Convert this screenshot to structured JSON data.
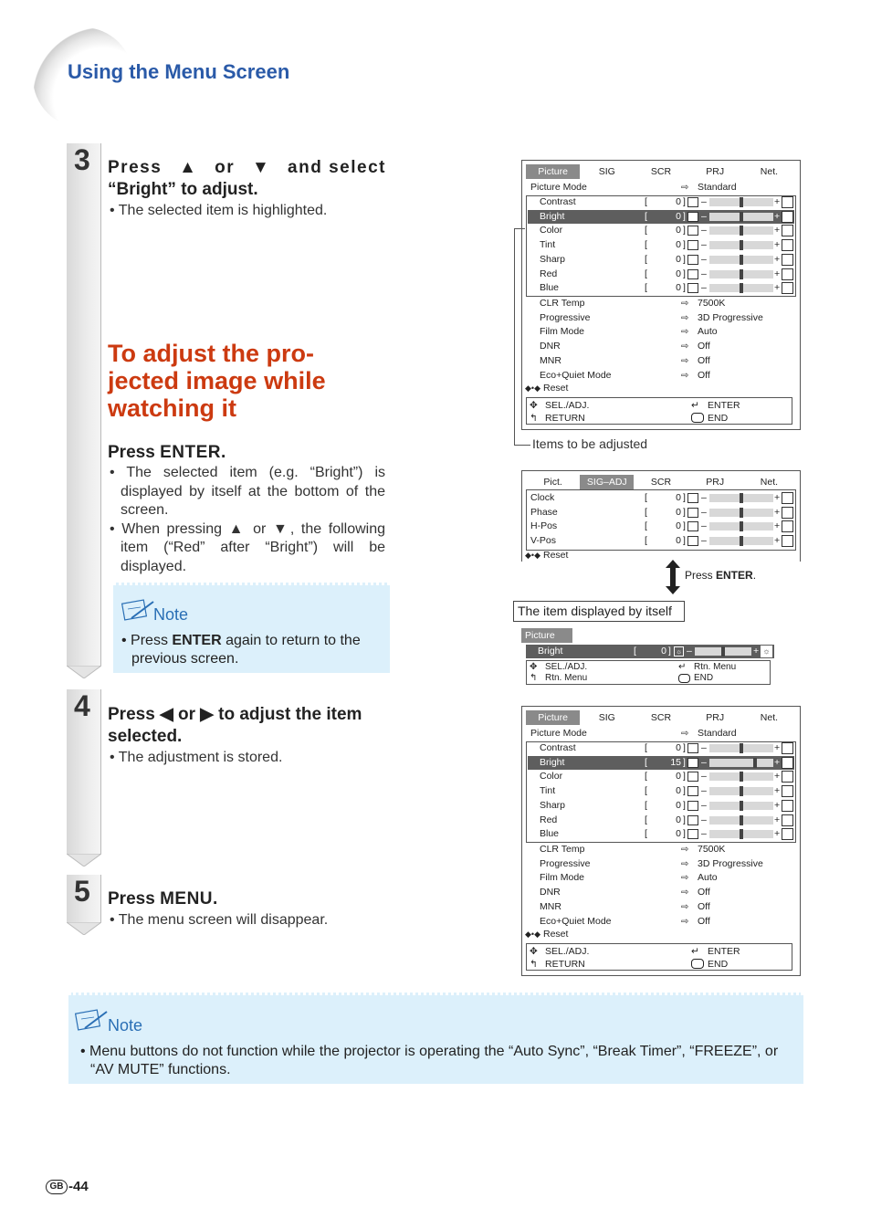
{
  "section_title": "Using the Menu Screen",
  "steps": [
    {
      "number": "3",
      "heading_parts": [
        "Press",
        "or",
        "and select “Bright” to adjust."
      ],
      "bullets": [
        "The selected item is highlighted."
      ]
    },
    {
      "number": "4",
      "heading_parts": [
        "Press",
        "or",
        "to adjust the item selected."
      ],
      "bullets": [
        "The adjustment is stored."
      ]
    },
    {
      "number": "5",
      "heading_parts": [
        "Press",
        "MENU",
        "."
      ],
      "bullets": [
        "The menu screen will disappear."
      ]
    }
  ],
  "subsection": {
    "title_lines": [
      "To adjust the pro-",
      "jected image while",
      "watching it"
    ],
    "press_label": "Press",
    "press_key": "ENTER",
    "press_suffix": ".",
    "bullets": [
      "The selected item (e.g. “Bright”) is displayed by itself at the bottom of the screen.",
      "When pressing ▲ or ▼, the following item (“Red” after “Bright”) will be displayed."
    ],
    "note": {
      "title": "Note",
      "text_pre": "Press ",
      "text_key": "ENTER",
      "text_post": " again to return to the previous screen."
    }
  },
  "bottom_note": {
    "title": "Note",
    "text": "Menu buttons do not function while the projector is operating the “Auto Sync”, “Break Timer”, “FREEZE”, or “AV MUTE” functions."
  },
  "annotations": {
    "items_to_adjust": "Items to be adjusted",
    "item_displayed_itself": "The item displayed by itself",
    "press_enter_pre": "Press ",
    "press_enter_key": "ENTER",
    "press_enter_post": "."
  },
  "menu1": {
    "tabs": [
      "Picture",
      "SIG",
      "SCR",
      "PRJ",
      "Net."
    ],
    "active_tab": 0,
    "picture_mode_label": "Picture Mode",
    "picture_mode_value": "Standard",
    "adjust_rows": [
      {
        "label": "Contrast",
        "value": "0",
        "level": 0.5,
        "icon": "contrast-icon"
      },
      {
        "label": "Bright",
        "value": "0",
        "level": 0.5,
        "icon": "brightness-icon",
        "highlight": true
      },
      {
        "label": "Color",
        "value": "0",
        "level": 0.5,
        "icon": "color-icon"
      },
      {
        "label": "Tint",
        "value": "0",
        "level": 0.5,
        "icon": "tint-icon"
      },
      {
        "label": "Sharp",
        "value": "0",
        "level": 0.5,
        "icon": "sharp-icon"
      },
      {
        "label": "Red",
        "value": "0",
        "level": 0.5,
        "icon": "red-icon"
      },
      {
        "label": "Blue",
        "value": "0",
        "level": 0.5,
        "icon": "blue-icon"
      }
    ],
    "setting_rows": [
      {
        "label": "CLR Temp",
        "value": "7500K"
      },
      {
        "label": "Progressive",
        "value": "3D Progressive"
      },
      {
        "label": "Film Mode",
        "value": "Auto"
      },
      {
        "label": "DNR",
        "value": "Off"
      },
      {
        "label": "MNR",
        "value": "Off"
      },
      {
        "label": "Eco+Quiet Mode",
        "value": "Off"
      }
    ],
    "reset_label": "Reset",
    "footer": {
      "sel_adj": "SEL./ADJ.",
      "return": "RETURN",
      "enter": "ENTER",
      "end": "END"
    }
  },
  "menu2": {
    "tabs": [
      "Pict.",
      "SIG–ADJ",
      "SCR",
      "PRJ",
      "Net."
    ],
    "active_tab": 1,
    "adjust_rows": [
      {
        "label": "Clock",
        "value": "0",
        "level": 0.5,
        "icon": "clock-icon"
      },
      {
        "label": "Phase",
        "value": "0",
        "level": 0.5,
        "icon": "phase-icon"
      },
      {
        "label": "H-Pos",
        "value": "0",
        "level": 0.5,
        "icon": "hpos-icon"
      },
      {
        "label": "V-Pos",
        "value": "0",
        "level": 0.5,
        "icon": "vpos-icon"
      }
    ],
    "reset_label": "Reset"
  },
  "menu_single": {
    "tab": "Picture",
    "row": {
      "label": "Bright",
      "value": "0",
      "level": 0.5
    },
    "footer": {
      "sel_adj": "SEL./ADJ.",
      "rtn_menu_left": "Rtn. Menu",
      "rtn_menu_right": "Rtn. Menu",
      "end": "END"
    }
  },
  "menu3": {
    "tabs": [
      "Picture",
      "SIG",
      "SCR",
      "PRJ",
      "Net."
    ],
    "active_tab": 0,
    "picture_mode_label": "Picture Mode",
    "picture_mode_value": "Standard",
    "adjust_rows": [
      {
        "label": "Contrast",
        "value": "0",
        "level": 0.5
      },
      {
        "label": "Bright",
        "value": "15",
        "level": 0.73,
        "highlight": true
      },
      {
        "label": "Color",
        "value": "0",
        "level": 0.5
      },
      {
        "label": "Tint",
        "value": "0",
        "level": 0.5
      },
      {
        "label": "Sharp",
        "value": "0",
        "level": 0.5
      },
      {
        "label": "Red",
        "value": "0",
        "level": 0.5
      },
      {
        "label": "Blue",
        "value": "0",
        "level": 0.5
      }
    ],
    "setting_rows": [
      {
        "label": "CLR Temp",
        "value": "7500K"
      },
      {
        "label": "Progressive",
        "value": "3D Progressive"
      },
      {
        "label": "Film Mode",
        "value": "Auto"
      },
      {
        "label": "DNR",
        "value": "Off"
      },
      {
        "label": "MNR",
        "value": "Off"
      },
      {
        "label": "Eco+Quiet Mode",
        "value": "Off"
      }
    ],
    "reset_label": "Reset",
    "footer": {
      "sel_adj": "SEL./ADJ.",
      "return": "RETURN",
      "enter": "ENTER",
      "end": "END"
    }
  },
  "page": {
    "region": "GB",
    "number": "-44"
  },
  "colors": {
    "accent_blue": "#2a5aa8",
    "title_red": "#cc3a10",
    "note_bg": "#dcf0fb"
  }
}
